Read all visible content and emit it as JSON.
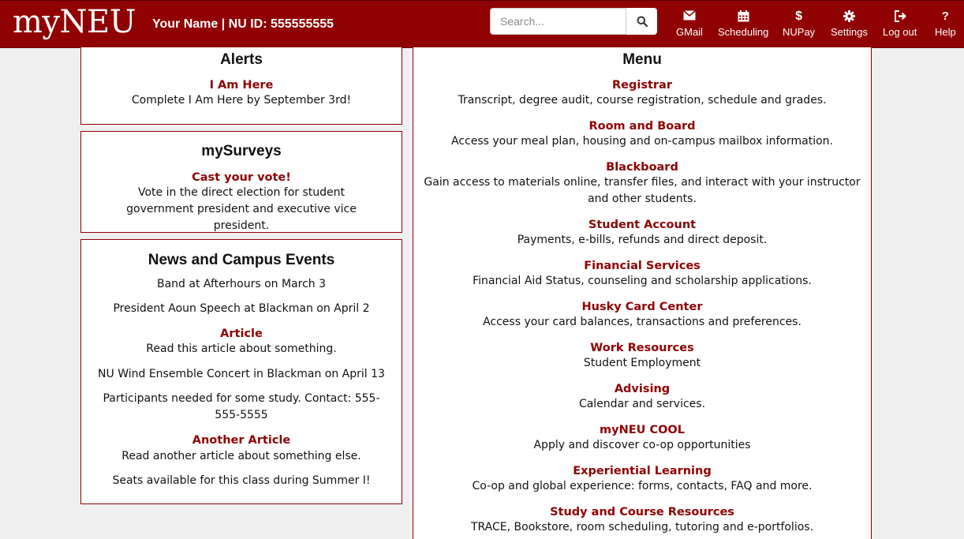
{
  "header": {
    "logo": "myNEU",
    "user_info": "Your Name | NU ID: 555555555",
    "search_placeholder": "Search...",
    "nav": [
      {
        "label": "GMail",
        "icon": "envelope-icon"
      },
      {
        "label": "Scheduling",
        "icon": "calendar-icon"
      },
      {
        "label": "NUPay",
        "icon": "dollar-icon"
      },
      {
        "label": "Settings",
        "icon": "gear-icon"
      },
      {
        "label": "Log out",
        "icon": "logout-icon"
      },
      {
        "label": "Help",
        "icon": "question-icon"
      }
    ]
  },
  "alerts": {
    "title": "Alerts",
    "items": [
      {
        "link": "I Am Here",
        "text": "Complete I Am Here by September 3rd!"
      }
    ]
  },
  "surveys": {
    "title": "mySurveys",
    "link": "Cast your vote!",
    "text": "Vote in the direct election for student government president and executive vice president."
  },
  "news": {
    "title": "News and Campus Events",
    "items": [
      {
        "text": "Band at Afterhours on March 3"
      },
      {
        "text": "President Aoun Speech at Blackman on April 2"
      },
      {
        "link": "Article",
        "text": "Read this article about something."
      },
      {
        "text": "NU Wind Ensemble Concert in Blackman on April 13"
      },
      {
        "text": "Participants needed for some study. Contact: 555-555-5555"
      },
      {
        "link": "Another Article",
        "text": "Read another article about something else."
      },
      {
        "text": "Seats available for this class during Summer I!"
      }
    ]
  },
  "menu": {
    "title": "Menu",
    "items": [
      {
        "link": "Registrar",
        "text": "Transcript, degree audit, course registration, schedule and grades."
      },
      {
        "link": "Room and Board",
        "text": "Access your meal plan, housing and on-campus mailbox information."
      },
      {
        "link": "Blackboard",
        "text": "Gain access to materials online, transfer files, and interact with your instructor and other students."
      },
      {
        "link": "Student Account",
        "text": "Payments, e-bills, refunds and direct deposit."
      },
      {
        "link": "Financial Services",
        "text": "Financial Aid Status, counseling and scholarship applications."
      },
      {
        "link": "Husky Card Center",
        "text": "Access your card balances, transactions and preferences."
      },
      {
        "link": "Work Resources",
        "text": "Student Employment"
      },
      {
        "link": "Advising",
        "text": "Calendar and services."
      },
      {
        "link": "myNEU COOL",
        "text": "Apply and discover co-op opportunities"
      },
      {
        "link": "Experiential Learning",
        "text": "Co-op and global experience: forms, contacts, FAQ and more."
      },
      {
        "link": "Study and Course Resources",
        "text": "TRACE, Bookstore, room scheduling, tutoring and e-portfolios."
      }
    ]
  },
  "colors": {
    "brand": "#8f0102",
    "background": "#efefef"
  }
}
